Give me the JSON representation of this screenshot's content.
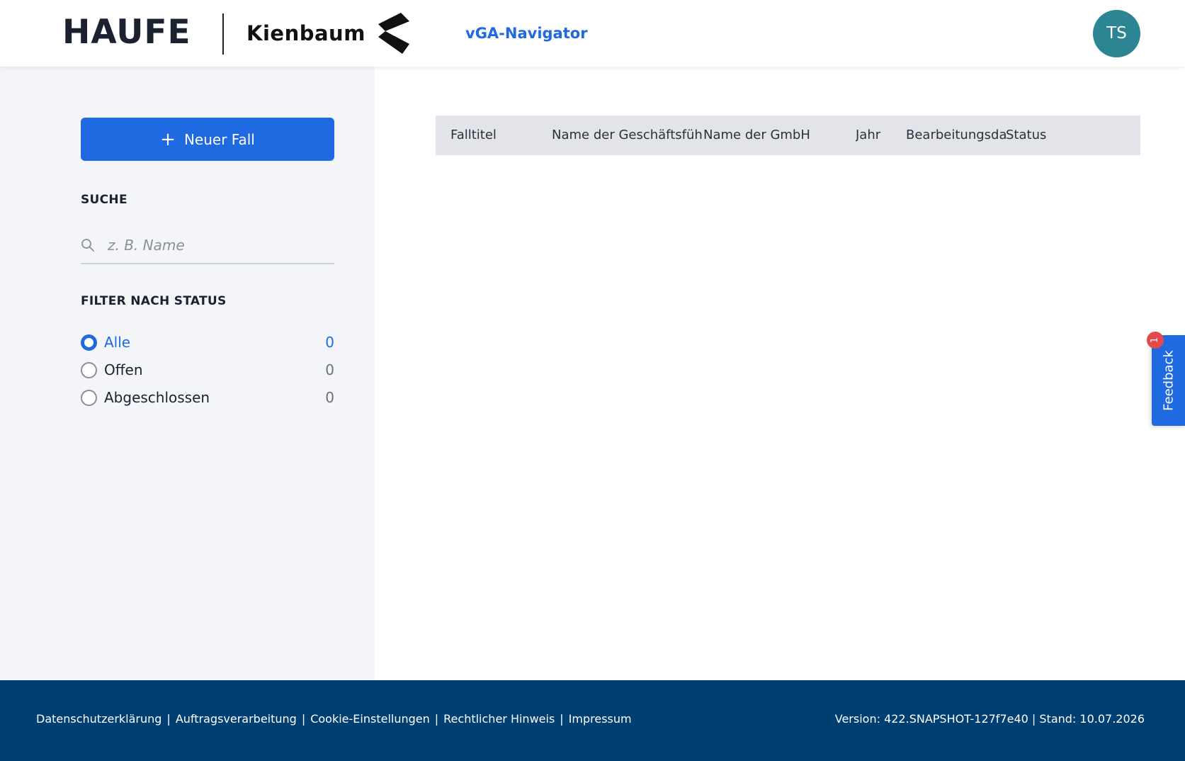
{
  "header": {
    "brand_haufe": "HAUFE",
    "brand_kienbaum": "Kienbaum",
    "app_title": "vGA-Navigator",
    "avatar_initials": "TS",
    "accent_color": "#1f6ae0",
    "avatar_color": "#2c8592"
  },
  "sidebar": {
    "new_case_label": "Neuer Fall",
    "search_heading": "SUCHE",
    "search_placeholder": "z. B. Name",
    "search_value": "",
    "filter_heading": "FILTER NACH STATUS",
    "filters": [
      {
        "label": "Alle",
        "count": "0",
        "selected": true
      },
      {
        "label": "Offen",
        "count": "0",
        "selected": false
      },
      {
        "label": "Abgeschlossen",
        "count": "0",
        "selected": false
      }
    ]
  },
  "table": {
    "columns": [
      "Falltitel",
      "Name der Geschäftsführu",
      "Name der GmbH",
      "Jahr",
      "Bearbeitungsdatı",
      "Status"
    ],
    "rows": []
  },
  "feedback": {
    "label": "Feedback",
    "badge_count": "1"
  },
  "footer": {
    "links": [
      "Datenschutzerklärung",
      "Auftragsverarbeitung",
      "Cookie-Einstellungen",
      "Rechtlicher Hinweis",
      "Impressum"
    ],
    "separator": "|",
    "version_text": "Version: 422.SNAPSHOT-127f7e40 | Stand: 10.07.2026",
    "background_color": "#003f72"
  }
}
